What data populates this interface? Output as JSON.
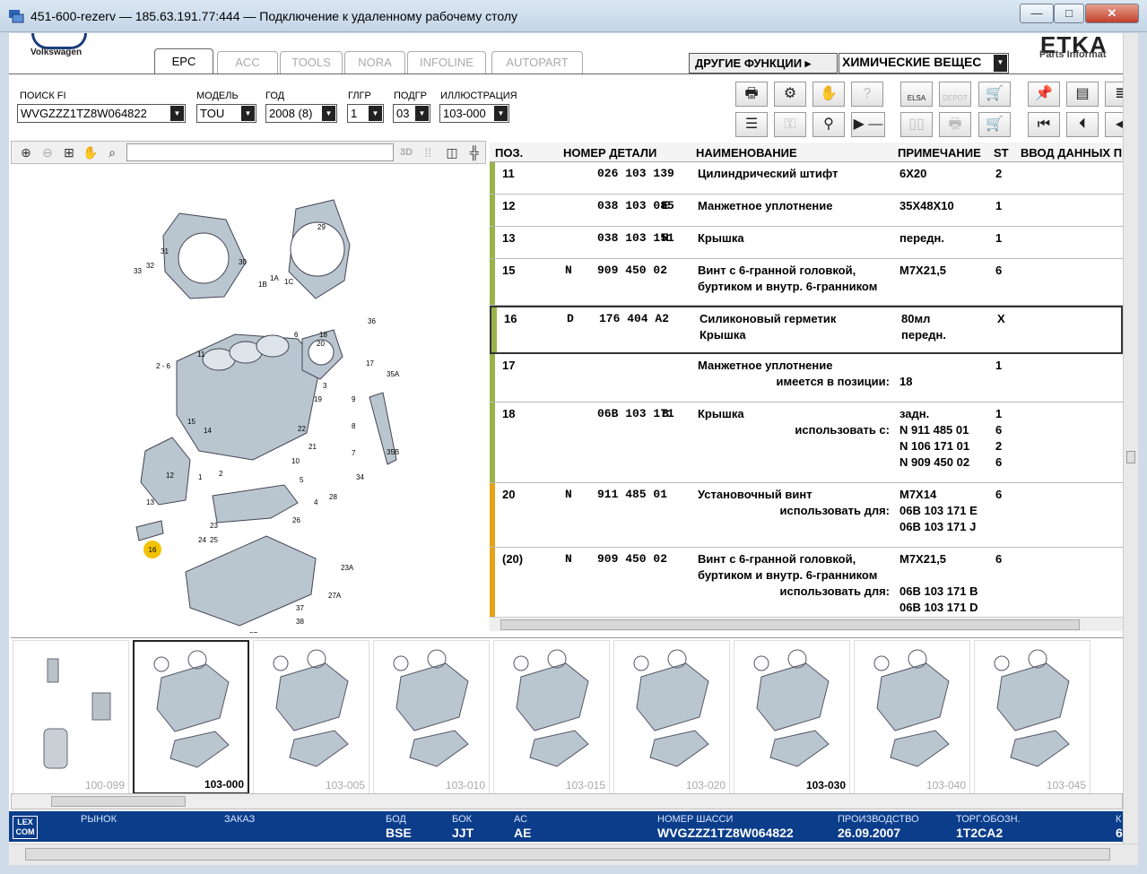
{
  "window": {
    "title": "451-600-rezerv — 185.63.191.77:444 — Подключение к удаленному рабочему столу",
    "minimize": "—",
    "maximize": "□",
    "close": "✕"
  },
  "header": {
    "brand": "Volkswagen",
    "product": "ETKA",
    "product_sub": "Parts Informat",
    "tabs": [
      {
        "label": "EPC",
        "active": true
      },
      {
        "label": "ACC",
        "active": false
      },
      {
        "label": "TOOLS",
        "active": false
      },
      {
        "label": "NORA",
        "active": false
      },
      {
        "label": "INFOLINE",
        "active": false
      },
      {
        "label": "AUTOPART",
        "active": false
      }
    ],
    "other_functions": "ДРУГИЕ ФУНКЦИИ ▸",
    "chem_select": "ХИМИЧЕСКИЕ ВЕЩЕС"
  },
  "search": {
    "fi_label": "ПОИСК FI",
    "fi_value": "WVGZZZ1TZ8W064822",
    "model_label": "МОДЕЛЬ",
    "model_value": "TOU",
    "year_label": "ГОД",
    "year_value": "2008 (8)",
    "mgroup_label": "ГЛГР",
    "mgroup_value": "1",
    "sgroup_label": "ПОДГР",
    "sgroup_value": "03",
    "illus_label": "ИЛЛЮСТРАЦИЯ",
    "illus_value": "103-000"
  },
  "toolbar_icons": {
    "elsa": "ELSA",
    "depot": "DEPOT"
  },
  "image_toolbar": {
    "view3d": "3D"
  },
  "table": {
    "headers": [
      "ПОЗ.",
      "НОМЕР ДЕТАЛИ",
      "НАИМЕНОВАНИЕ",
      "ПРИМЕЧАНИЕ",
      "ST",
      "ВВОД ДАННЫХ П"
    ],
    "rows": [
      {
        "pos": "11",
        "a": "",
        "num": "026 103 139",
        "suf": "",
        "name": [
          "Цилиндрический штифт"
        ],
        "note": [
          "6X20"
        ],
        "st": [
          "2"
        ],
        "bar": "#9ab24a"
      },
      {
        "pos": "12",
        "a": "",
        "num": "038 103 085",
        "suf": "E",
        "name": [
          "Манжетное уплотнение"
        ],
        "note": [
          "35X48X10"
        ],
        "st": [
          "1"
        ],
        "bar": "#9ab24a"
      },
      {
        "pos": "13",
        "a": "",
        "num": "038 103 151",
        "suf": "H",
        "name": [
          "Крышка"
        ],
        "note": [
          "передн."
        ],
        "st": [
          "1"
        ],
        "bar": "#9ab24a"
      },
      {
        "pos": "15",
        "a": "N",
        "num": "909 450 02",
        "suf": "",
        "name": [
          "Винт с 6-гранной головкой,",
          "буртиком и внутр. 6-гранником"
        ],
        "note": [
          "M7X21,5"
        ],
        "st": [
          "6"
        ],
        "bar": "#9ab24a"
      },
      {
        "pos": "16",
        "a": "D",
        "num": "176 404 A2",
        "suf": "",
        "name": [
          "Силиконовый герметик",
          "Крышка"
        ],
        "note": [
          "80мл",
          "передн."
        ],
        "st": [
          "X"
        ],
        "bar": "#9ab24a"
      },
      {
        "pos": "17",
        "a": "",
        "num": "",
        "suf": "",
        "name": [
          "Манжетное уплотнение",
          ">имеется в позиции:"
        ],
        "note": [
          "",
          "18"
        ],
        "st": [
          "1"
        ],
        "bar": "#9ab24a"
      },
      {
        "pos": "18",
        "a": "",
        "num": "06B 103 171",
        "suf": "B",
        "name": [
          "Крышка",
          ">использовать с:"
        ],
        "note": [
          "задн.",
          "N   911 485 01",
          "N   106 171 01",
          "N   909 450 02"
        ],
        "st": [
          "1",
          "6",
          "2",
          "6"
        ],
        "bar": "#9ab24a"
      },
      {
        "pos": "20",
        "a": "N",
        "num": "911 485 01",
        "suf": "",
        "name": [
          "Установочный винт",
          ">использовать для:"
        ],
        "note": [
          "M7X14",
          "06B 103 171 E",
          "06B 103 171 J"
        ],
        "st": [
          "6"
        ],
        "bar": "#e3a21a"
      },
      {
        "pos": "(20)",
        "a": "N",
        "num": "909 450 02",
        "suf": "",
        "name": [
          "Винт с 6-гранной головкой,",
          "буртиком и внутр. 6-гранником",
          ">использовать для:"
        ],
        "note": [
          "M7X21,5",
          "",
          "06B 103 171 B",
          "06B 103 171 D"
        ],
        "st": [
          "6"
        ],
        "bar": "#e3a21a"
      }
    ]
  },
  "diagram": {
    "callouts": [
      "29",
      "31",
      "30",
      "32",
      "33",
      "1B",
      "1A",
      "1C",
      "36",
      "11",
      "6",
      "18",
      "2 - 6",
      "17",
      "35A",
      "35B",
      "10",
      "7",
      "8",
      "9",
      "2",
      "1",
      "26",
      "28",
      "16",
      "23",
      "24",
      "25",
      "23A",
      "27A",
      "37",
      "38",
      "27",
      "15",
      "14",
      "21",
      "22",
      "5",
      "4",
      "3",
      "12",
      "13",
      "19",
      "20",
      "34"
    ],
    "highlight": "16"
  },
  "thumbnails": [
    {
      "label": "100-099",
      "current": false
    },
    {
      "label": "103-000",
      "current": true
    },
    {
      "label": "103-005",
      "current": false
    },
    {
      "label": "103-010",
      "current": false
    },
    {
      "label": "103-015",
      "current": false
    },
    {
      "label": "103-020",
      "current": false
    },
    {
      "label": "103-030",
      "current": true
    },
    {
      "label": "103-040",
      "current": false
    },
    {
      "label": "103-045",
      "current": false
    }
  ],
  "status": {
    "logo": "LEX COM",
    "market_label": "РЫНОК",
    "order_label": "ЗАКАЗ",
    "bod_label": "БОД",
    "bod_value": "BSE",
    "bok_label": "БОК",
    "bok_value": "JJT",
    "ac_label": "АС",
    "ac_value": "AE",
    "chassis_label": "НОМЕР ШАССИ",
    "chassis_value": "WVGZZZ1TZ8W064822",
    "prod_label": "ПРОИЗВОДСТВО",
    "prod_value": "26.09.2007",
    "trade_label": "ТОРГ.ОБОЗН.",
    "trade_value": "1T2CA2",
    "k_label": "К",
    "k_value": "6"
  },
  "colors": {
    "status_bar": "#0b3d8a",
    "callout_highlight": "#f2c200",
    "row_bar_green": "#9ab24a",
    "row_bar_orange": "#e3a21a"
  }
}
